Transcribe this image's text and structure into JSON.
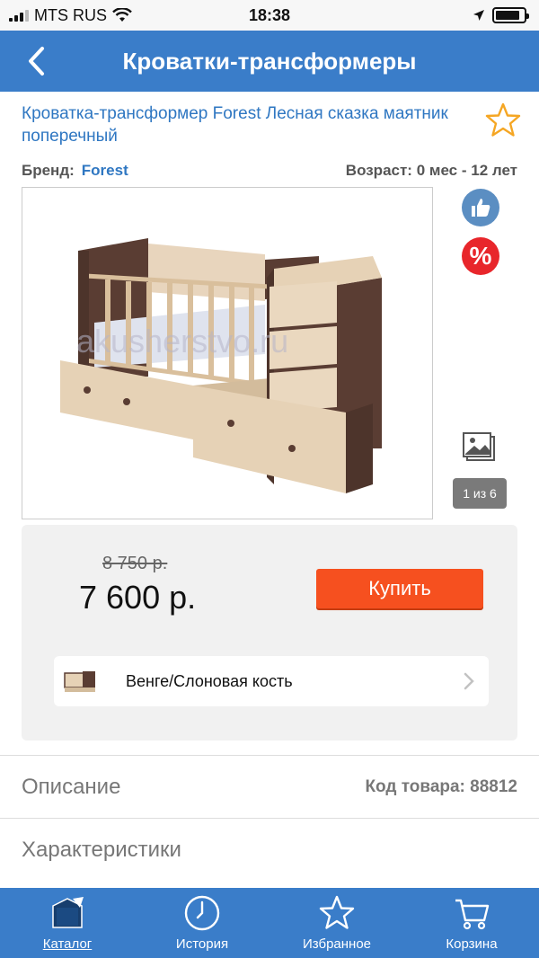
{
  "status_bar": {
    "carrier": "MTS RUS",
    "time": "18:38",
    "battery_level": 0.85
  },
  "nav": {
    "title": "Кроватки-трансформеры",
    "back_icon": "chevron-left-icon"
  },
  "product": {
    "title": "Кроватка-трансформер Forest Лесная сказка маятник поперечный",
    "brand_label": "Бренд:",
    "brand": "Forest",
    "age": "Возраст: 0 мес - 12 лет",
    "watermark": "akusherstvo.ru",
    "gallery_count": "1 из 6",
    "sale_badge": "%",
    "old_price": "8 750 р.",
    "price": "7 600 р.",
    "buy_label": "Купить",
    "variant": "Венге/Слоновая кость"
  },
  "sections": {
    "description": "Описание",
    "code": "Код товара: 88812",
    "characteristics": "Характеристики"
  },
  "tabs": [
    {
      "label": "Каталог",
      "icon": "catalog-icon",
      "active": true
    },
    {
      "label": "История",
      "icon": "clock-icon",
      "active": false
    },
    {
      "label": "Избранное",
      "icon": "star-icon",
      "active": false
    },
    {
      "label": "Корзина",
      "icon": "cart-icon",
      "active": false
    }
  ],
  "colors": {
    "primary": "#3a7dc9",
    "link": "#2f77c2",
    "buy": "#f6501f",
    "sale": "#e8262b",
    "star": "#f5a623"
  }
}
